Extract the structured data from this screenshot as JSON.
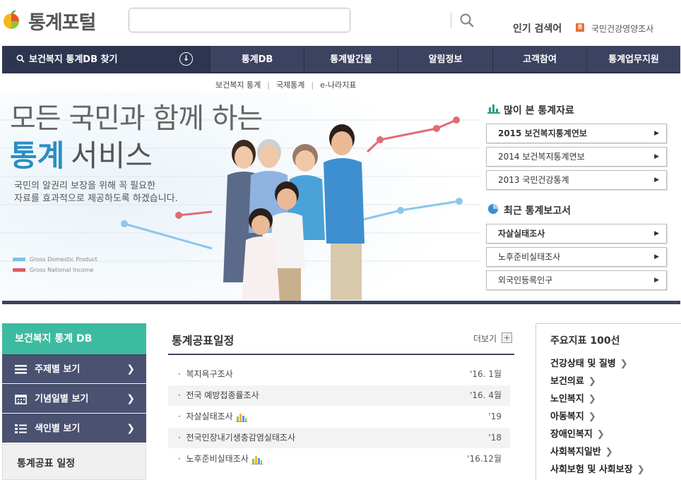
{
  "header": {
    "logo_text": "통계포털",
    "search": {
      "value": "",
      "placeholder": ""
    },
    "popular_label": "인기 검색어",
    "popular_rank": "8",
    "popular_item": "국민건강영양조사"
  },
  "nav": {
    "find_label": "보건복지 통계DB 찾기",
    "items": [
      "통계DB",
      "통계발간물",
      "알림정보",
      "고객참여",
      "통계업무지원"
    ],
    "subnav": [
      "보건복지 통계",
      "국제통계",
      "e-나라지표"
    ]
  },
  "hero": {
    "line1": "모든 국민과 함께 하는",
    "line2_accent": "통계",
    "line2_rest": "서비스",
    "desc_line1": "국민의 알권리 보장을 위해 꼭 필요한",
    "desc_line2": "자료를 효과적으로 제공하도록 하겠습니다.",
    "legend_gdp": "Gross Domestic Product",
    "legend_gni": "Gross National Income"
  },
  "most_viewed": {
    "title": "많이 본 통계자료",
    "items": [
      "2015 보건복지통계연보",
      "2014 보건복지통계연보",
      "2013 국민건강통계"
    ]
  },
  "recent_reports": {
    "title": "최근 통계보고서",
    "items": [
      "자살실태조사",
      "노후준비실태조사",
      "외국인등록인구"
    ]
  },
  "left_panel": {
    "title": "보건복지 통계 DB",
    "buttons": [
      "주제별 보기",
      "기념일별 보기",
      "색인별 보기"
    ],
    "schedule_title": "통계공표 일정"
  },
  "schedule": {
    "title": "통계공표일정",
    "more": "더보기",
    "rows": [
      {
        "name": "복지욕구조사",
        "date": "'16. 1월",
        "chart": false
      },
      {
        "name": "전국 예방접종률조사",
        "date": "'16. 4월",
        "chart": false
      },
      {
        "name": "자살실태조사",
        "date": "'19",
        "chart": true
      },
      {
        "name": "전국민장내기생충감염실태조사",
        "date": "'18",
        "chart": false
      },
      {
        "name": "노후준비실태조사",
        "date": "'16.12월",
        "chart": true
      }
    ]
  },
  "indicators": {
    "title": "주요지표 100선",
    "items": [
      "건강상태 및 질병",
      "보건의료",
      "노인복지",
      "아동복지",
      "장애인복지",
      "사회복지일반",
      "사회보험 및 사회보장"
    ]
  },
  "colors": {
    "nav_bg": "#3c4360",
    "accent_teal": "#3dbba0",
    "accent_blue": "#2a8ec4",
    "gdp": "#7ec0e8",
    "gni": "#e05a63"
  }
}
